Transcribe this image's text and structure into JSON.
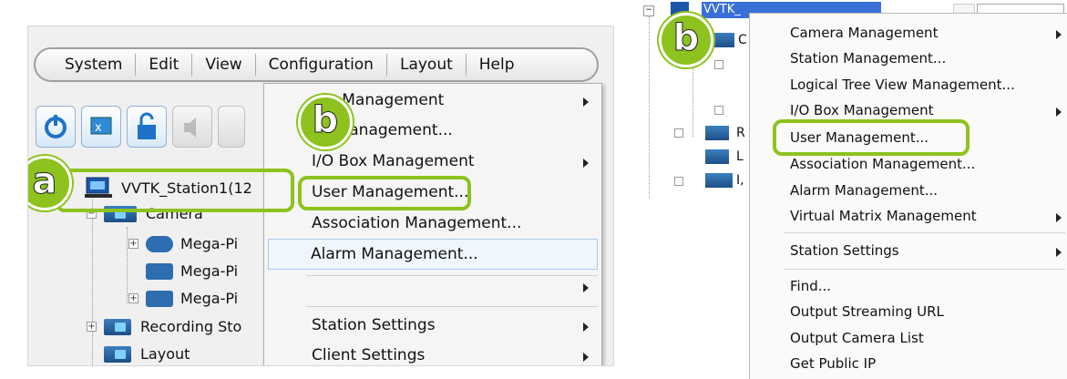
{
  "left": {
    "menubar": [
      "System",
      "Edit",
      "View",
      "Configuration",
      "Layout",
      "Help"
    ],
    "tree": {
      "station": "VVTK_Station1(12",
      "camera_folder": "Camera",
      "cameras": [
        "Mega-Pi",
        "Mega-Pi",
        "Mega-Pi"
      ],
      "recording": "Recording Sto",
      "layout": "Layout"
    },
    "context_menu": [
      {
        "label": "era Management",
        "submenu": true
      },
      {
        "label": "on Management...",
        "submenu": false
      },
      {
        "label": "I/O Box Management",
        "submenu": true
      },
      {
        "label": "User Management...",
        "submenu": false
      },
      {
        "label": "Association Management...",
        "submenu": false
      },
      {
        "label": "Alarm Management...",
        "submenu": false
      },
      {
        "label": "",
        "submenu": true
      },
      {
        "label": "Station Settings",
        "submenu": true
      },
      {
        "label": "Client Settings",
        "submenu": true
      }
    ],
    "badges": {
      "a": "a",
      "b": "b"
    }
  },
  "right": {
    "tree": {
      "station": "VVTK_",
      "items": [
        "C",
        "R",
        "L",
        "I,"
      ]
    },
    "context_menu": [
      {
        "label": "Camera Management",
        "submenu": true
      },
      {
        "label": "Station Management...",
        "submenu": false
      },
      {
        "label": "Logical Tree View Management...",
        "submenu": false
      },
      {
        "label": "I/O Box Management",
        "submenu": true
      },
      {
        "label": "User Management...",
        "submenu": false
      },
      {
        "label": "Association Management...",
        "submenu": false
      },
      {
        "label": "Alarm Management...",
        "submenu": false
      },
      {
        "label": "Virtual Matrix Management",
        "submenu": true
      },
      {
        "label": "Station Settings",
        "submenu": true
      },
      {
        "label": "Find...",
        "submenu": false
      },
      {
        "label": "Output Streaming URL",
        "submenu": false
      },
      {
        "label": "Output Camera List",
        "submenu": false
      },
      {
        "label": "Get Public IP",
        "submenu": false
      }
    ],
    "badge": "b"
  },
  "colors": {
    "highlight": "#8dc21f",
    "selection": "#3a6fd8"
  }
}
